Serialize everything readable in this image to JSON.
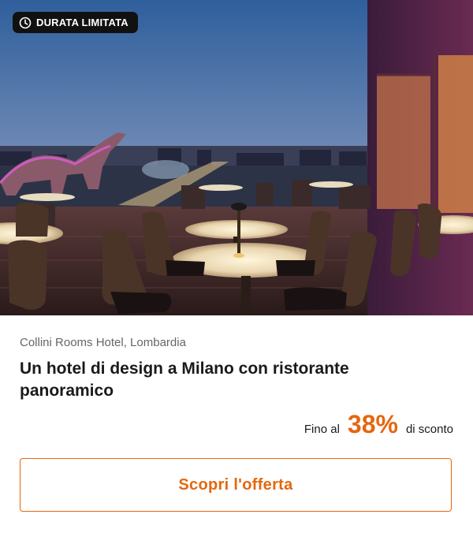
{
  "badge": {
    "icon": "clock-icon",
    "label": "DURATA LIMITATA"
  },
  "hero": {
    "subject": "rooftop-restaurant-terrace"
  },
  "offer": {
    "location": "Collini Rooms Hotel, Lombardia",
    "title": "Un hotel di design a Milano con ristorante panoramico",
    "discount_prefix": "Fino al",
    "discount_value": "38%",
    "discount_suffix": "di sconto",
    "cta_label": "Scopri l'offerta"
  },
  "colors": {
    "accent": "#e5670f",
    "badge_bg": "#111111",
    "text_primary": "#1a1a1a",
    "text_secondary": "#666666"
  }
}
